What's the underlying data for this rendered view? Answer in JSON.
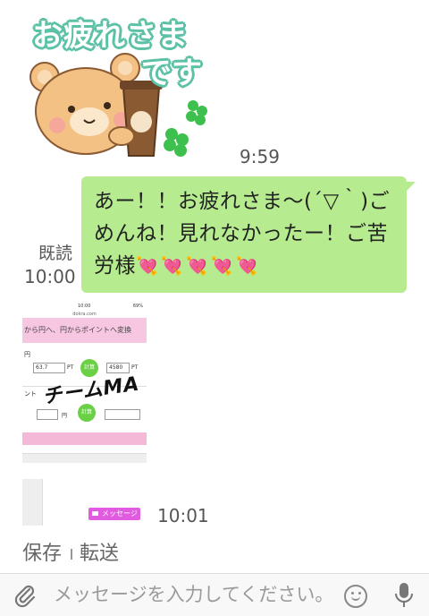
{
  "sticker": {
    "line1": "お疲れさま",
    "line2": "です"
  },
  "messages": {
    "sticker_time": "9:59",
    "bubble_text": "あー！！お疲れさま～(´▽｀)ごめんね！見れなかったー！ご苦労様",
    "bubble_hearts": "💘💘💘💘💘",
    "read_label": "既読",
    "read_time": "10:00",
    "image_time": "10:01",
    "image_badge": "メッセージ"
  },
  "screenshot": {
    "status": "10:00",
    "battery": "69%",
    "url": "dokra.com",
    "header": "から円へ、円からポイントへ変換",
    "unit_yen": "円",
    "field1": "63.7",
    "unit_pt": "PT",
    "calc": "計算",
    "field2": "4580",
    "unit_pt2": "PT",
    "overlay": "チームMA",
    "unit_yen2": "円",
    "row2_label": "ント"
  },
  "actions": {
    "save": "保存",
    "forward": "転送"
  },
  "input": {
    "placeholder": "メッセージを入力してください。"
  },
  "colors": {
    "bubble": "#b6ec8f",
    "badge": "#e05be0",
    "sticker_outline": "#5cc1a6"
  },
  "icons": {
    "attach": "paperclip-icon",
    "emoji": "smiley-icon",
    "voice": "microphone-icon"
  }
}
